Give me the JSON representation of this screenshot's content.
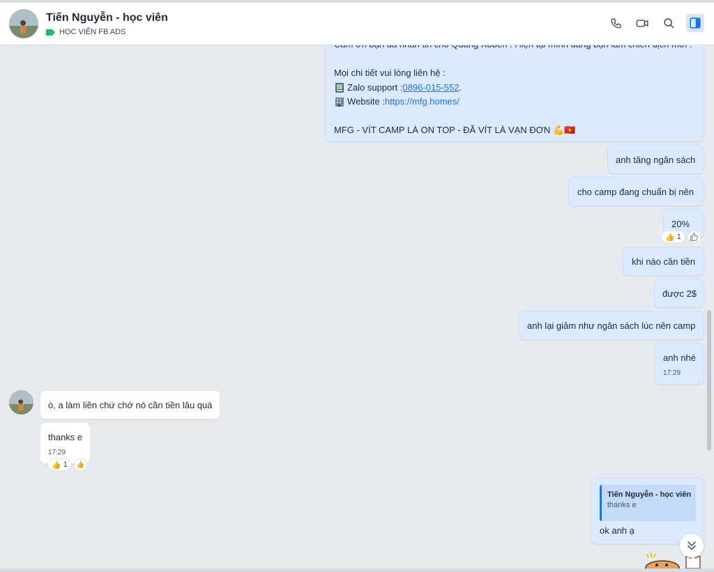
{
  "header": {
    "contact_name": "Tiến Nguyễn - học viên",
    "label_tag": "HỌC VIÊN FB ADS",
    "label_color": "#2fb36a",
    "icons": [
      "phone-icon",
      "video-call-icon",
      "search-icon",
      "side-panel-icon"
    ]
  },
  "messages": {
    "auto_reply": {
      "line1": "Cảm ơn bạn đã nhắn tin cho Quang Koben . Hiện tại mình đang bận làm chiến dịch mới .",
      "line2": "Mọi chi tiết vui lòng liên hệ :",
      "zalo_label": "Zalo support : ",
      "zalo_phone": "0896-015-552",
      "zalo_suffix": " .",
      "web_label": " Website : ",
      "web_url": "https://mfg.homes/",
      "slogan": "MFG - VÍT CAMP LÀ ON TOP - ĐÃ VÍT LÀ VẠN ĐƠN",
      "emoji_flex": "💪",
      "emoji_flag": "🇻🇳"
    },
    "m1": "anh tăng ngân sách",
    "m2": "cho camp đang chuẩn bị nên",
    "m3": "20%",
    "m3_reaction_emoji": "👍",
    "m3_reaction_count": "1",
    "m4": "khi nào cần tiền",
    "m5": "được 2$",
    "m6": "anh lại giảm như ngân sách lúc nên camp",
    "m7": "anh nhé",
    "m7_time": "17:29",
    "in1": "ò, a làm liền chứ chớ nó cần tiền lâu quá",
    "in2": "thanks e",
    "in2_time": "17:29",
    "in2_reaction_emoji": "👍",
    "in2_reaction_count": "1",
    "in2_reaction_add": "👍",
    "reply_quote_name": "Tiến Nguyễn - học viên",
    "reply_quote_text": "thanks e",
    "reply_text": "ok anh ạ"
  },
  "colors": {
    "outgoing_bubble": "#dbeafe",
    "incoming_bubble": "#ffffff",
    "link": "#1a73e8",
    "background": "#e7eaee"
  }
}
